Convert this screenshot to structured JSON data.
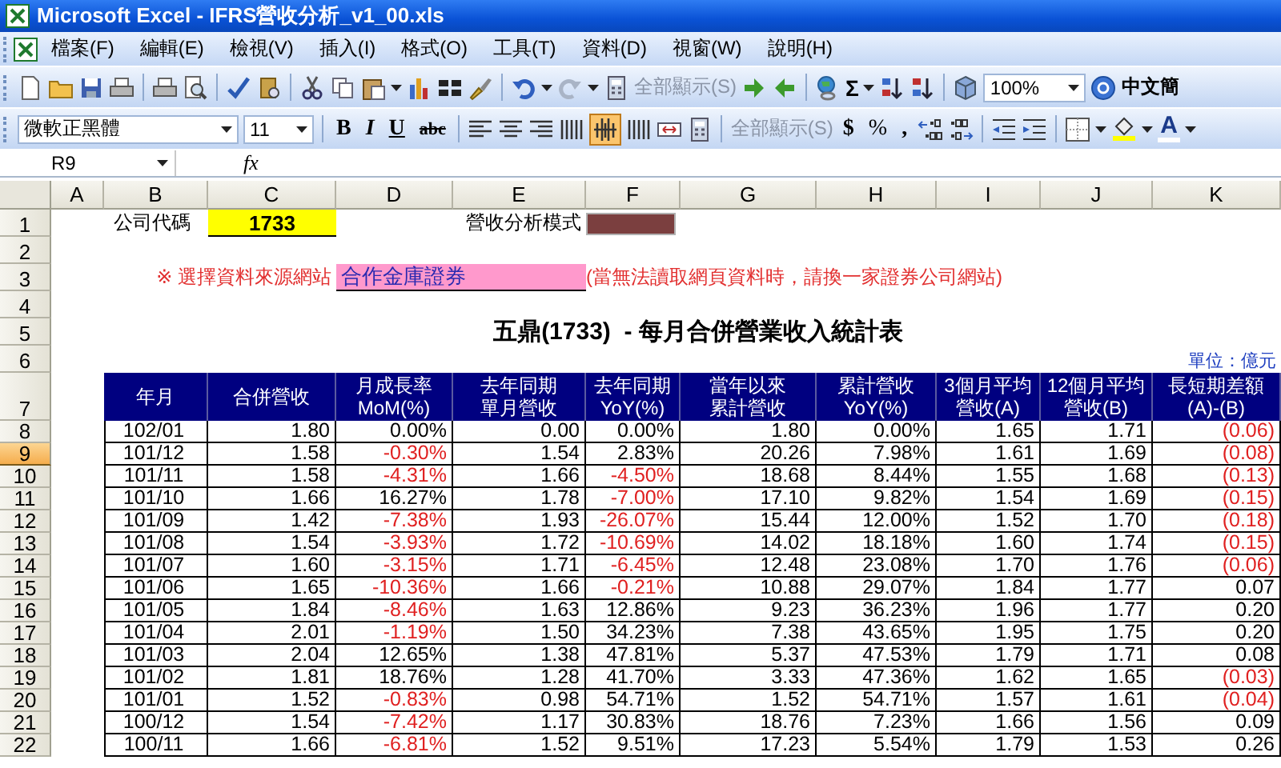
{
  "window": {
    "title": "Microsoft Excel - IFRS營收分析_v1_00.xls"
  },
  "menu": [
    "檔案(F)",
    "編輯(E)",
    "檢視(V)",
    "插入(I)",
    "格式(O)",
    "工具(T)",
    "資料(D)",
    "視窗(W)",
    "說明(H)"
  ],
  "standard_toolbar": {
    "show_all": "全部顯示(S)",
    "sum": "Σ",
    "zoom": "100%",
    "language": "中文簡"
  },
  "formatting_toolbar": {
    "font": "微軟正黑體",
    "size": "11",
    "bold": "B",
    "italic": "I",
    "underline": "U",
    "strikethrough": "abc",
    "distributed_selected": true,
    "show_all": "全部顯示(S)",
    "currency": "$",
    "percent": "%",
    "comma": ",",
    "font_color": "A"
  },
  "formula_bar": {
    "name_box": "R9",
    "function_label": "fx"
  },
  "columns": [
    "A",
    "B",
    "C",
    "D",
    "E",
    "F",
    "G",
    "H",
    "I",
    "J",
    "K"
  ],
  "rows": [
    {
      "label": "1",
      "selected": false
    },
    {
      "label": "2",
      "selected": false
    },
    {
      "label": "3",
      "selected": false
    },
    {
      "label": "4",
      "selected": false
    },
    {
      "label": "5",
      "selected": false
    },
    {
      "label": "6",
      "selected": false
    },
    {
      "label": "7",
      "selected": false
    },
    {
      "label": "8",
      "selected": false
    },
    {
      "label": "9",
      "selected": true
    },
    {
      "label": "10",
      "selected": false
    },
    {
      "label": "11",
      "selected": false
    },
    {
      "label": "12",
      "selected": false
    },
    {
      "label": "13",
      "selected": false
    },
    {
      "label": "14",
      "selected": false
    },
    {
      "label": "15",
      "selected": false
    },
    {
      "label": "16",
      "selected": false
    },
    {
      "label": "17",
      "selected": false
    },
    {
      "label": "18",
      "selected": false
    },
    {
      "label": "19",
      "selected": false
    },
    {
      "label": "20",
      "selected": false
    },
    {
      "label": "21",
      "selected": false
    },
    {
      "label": "22",
      "selected": false
    }
  ],
  "sheet": {
    "company_code_label": "公司代碼",
    "company_code": "1733",
    "mode_label": "營收分析模式",
    "source_label": "※ 選擇資料來源網站",
    "source": "合作金庫證券",
    "source_note": "(當無法讀取網頁資料時，請換一家證券公司網站)",
    "title": "五鼎(1733)  - 每月合併營業收入統計表",
    "unit": "單位：億元"
  },
  "table": {
    "columns": [
      "年月",
      "合併營收",
      "月成長率MoM(%)",
      "去年同期單月營收",
      "去年同期YoY(%)",
      "當年以來累計營收",
      "累計營收YoY(%)",
      "3個月平均營收(A)",
      "12個月平均營收(B)",
      "長短期差額(A)-(B)"
    ],
    "rows": [
      {
        "cells": [
          {
            "value": "102/01",
            "negative": false
          },
          {
            "value": "1.80",
            "negative": false
          },
          {
            "value": "0.00%",
            "negative": false
          },
          {
            "value": "0.00",
            "negative": false
          },
          {
            "value": "0.00%",
            "negative": false
          },
          {
            "value": "1.80",
            "negative": false
          },
          {
            "value": "0.00%",
            "negative": false
          },
          {
            "value": "1.65",
            "negative": false
          },
          {
            "value": "1.71",
            "negative": false
          },
          {
            "value": "(0.06)",
            "negative": true
          }
        ]
      },
      {
        "cells": [
          {
            "value": "101/12",
            "negative": false
          },
          {
            "value": "1.58",
            "negative": false
          },
          {
            "value": "-0.30%",
            "negative": true
          },
          {
            "value": "1.54",
            "negative": false
          },
          {
            "value": "2.83%",
            "negative": false
          },
          {
            "value": "20.26",
            "negative": false
          },
          {
            "value": "7.98%",
            "negative": false
          },
          {
            "value": "1.61",
            "negative": false
          },
          {
            "value": "1.69",
            "negative": false
          },
          {
            "value": "(0.08)",
            "negative": true
          }
        ]
      },
      {
        "cells": [
          {
            "value": "101/11",
            "negative": false
          },
          {
            "value": "1.58",
            "negative": false
          },
          {
            "value": "-4.31%",
            "negative": true
          },
          {
            "value": "1.66",
            "negative": false
          },
          {
            "value": "-4.50%",
            "negative": true
          },
          {
            "value": "18.68",
            "negative": false
          },
          {
            "value": "8.44%",
            "negative": false
          },
          {
            "value": "1.55",
            "negative": false
          },
          {
            "value": "1.68",
            "negative": false
          },
          {
            "value": "(0.13)",
            "negative": true
          }
        ]
      },
      {
        "cells": [
          {
            "value": "101/10",
            "negative": false
          },
          {
            "value": "1.66",
            "negative": false
          },
          {
            "value": "16.27%",
            "negative": false
          },
          {
            "value": "1.78",
            "negative": false
          },
          {
            "value": "-7.00%",
            "negative": true
          },
          {
            "value": "17.10",
            "negative": false
          },
          {
            "value": "9.82%",
            "negative": false
          },
          {
            "value": "1.54",
            "negative": false
          },
          {
            "value": "1.69",
            "negative": false
          },
          {
            "value": "(0.15)",
            "negative": true
          }
        ]
      },
      {
        "cells": [
          {
            "value": "101/09",
            "negative": false
          },
          {
            "value": "1.42",
            "negative": false
          },
          {
            "value": "-7.38%",
            "negative": true
          },
          {
            "value": "1.93",
            "negative": false
          },
          {
            "value": "-26.07%",
            "negative": true
          },
          {
            "value": "15.44",
            "negative": false
          },
          {
            "value": "12.00%",
            "negative": false
          },
          {
            "value": "1.52",
            "negative": false
          },
          {
            "value": "1.70",
            "negative": false
          },
          {
            "value": "(0.18)",
            "negative": true
          }
        ]
      },
      {
        "cells": [
          {
            "value": "101/08",
            "negative": false
          },
          {
            "value": "1.54",
            "negative": false
          },
          {
            "value": "-3.93%",
            "negative": true
          },
          {
            "value": "1.72",
            "negative": false
          },
          {
            "value": "-10.69%",
            "negative": true
          },
          {
            "value": "14.02",
            "negative": false
          },
          {
            "value": "18.18%",
            "negative": false
          },
          {
            "value": "1.60",
            "negative": false
          },
          {
            "value": "1.74",
            "negative": false
          },
          {
            "value": "(0.15)",
            "negative": true
          }
        ]
      },
      {
        "cells": [
          {
            "value": "101/07",
            "negative": false
          },
          {
            "value": "1.60",
            "negative": false
          },
          {
            "value": "-3.15%",
            "negative": true
          },
          {
            "value": "1.71",
            "negative": false
          },
          {
            "value": "-6.45%",
            "negative": true
          },
          {
            "value": "12.48",
            "negative": false
          },
          {
            "value": "23.08%",
            "negative": false
          },
          {
            "value": "1.70",
            "negative": false
          },
          {
            "value": "1.76",
            "negative": false
          },
          {
            "value": "(0.06)",
            "negative": true
          }
        ]
      },
      {
        "cells": [
          {
            "value": "101/06",
            "negative": false
          },
          {
            "value": "1.65",
            "negative": false
          },
          {
            "value": "-10.36%",
            "negative": true
          },
          {
            "value": "1.66",
            "negative": false
          },
          {
            "value": "-0.21%",
            "negative": true
          },
          {
            "value": "10.88",
            "negative": false
          },
          {
            "value": "29.07%",
            "negative": false
          },
          {
            "value": "1.84",
            "negative": false
          },
          {
            "value": "1.77",
            "negative": false
          },
          {
            "value": "0.07",
            "negative": false
          }
        ]
      },
      {
        "cells": [
          {
            "value": "101/05",
            "negative": false
          },
          {
            "value": "1.84",
            "negative": false
          },
          {
            "value": "-8.46%",
            "negative": true
          },
          {
            "value": "1.63",
            "negative": false
          },
          {
            "value": "12.86%",
            "negative": false
          },
          {
            "value": "9.23",
            "negative": false
          },
          {
            "value": "36.23%",
            "negative": false
          },
          {
            "value": "1.96",
            "negative": false
          },
          {
            "value": "1.77",
            "negative": false
          },
          {
            "value": "0.20",
            "negative": false
          }
        ]
      },
      {
        "cells": [
          {
            "value": "101/04",
            "negative": false
          },
          {
            "value": "2.01",
            "negative": false
          },
          {
            "value": "-1.19%",
            "negative": true
          },
          {
            "value": "1.50",
            "negative": false
          },
          {
            "value": "34.23%",
            "negative": false
          },
          {
            "value": "7.38",
            "negative": false
          },
          {
            "value": "43.65%",
            "negative": false
          },
          {
            "value": "1.95",
            "negative": false
          },
          {
            "value": "1.75",
            "negative": false
          },
          {
            "value": "0.20",
            "negative": false
          }
        ]
      },
      {
        "cells": [
          {
            "value": "101/03",
            "negative": false
          },
          {
            "value": "2.04",
            "negative": false
          },
          {
            "value": "12.65%",
            "negative": false
          },
          {
            "value": "1.38",
            "negative": false
          },
          {
            "value": "47.81%",
            "negative": false
          },
          {
            "value": "5.37",
            "negative": false
          },
          {
            "value": "47.53%",
            "negative": false
          },
          {
            "value": "1.79",
            "negative": false
          },
          {
            "value": "1.71",
            "negative": false
          },
          {
            "value": "0.08",
            "negative": false
          }
        ]
      },
      {
        "cells": [
          {
            "value": "101/02",
            "negative": false
          },
          {
            "value": "1.81",
            "negative": false
          },
          {
            "value": "18.76%",
            "negative": false
          },
          {
            "value": "1.28",
            "negative": false
          },
          {
            "value": "41.70%",
            "negative": false
          },
          {
            "value": "3.33",
            "negative": false
          },
          {
            "value": "47.36%",
            "negative": false
          },
          {
            "value": "1.62",
            "negative": false
          },
          {
            "value": "1.65",
            "negative": false
          },
          {
            "value": "(0.03)",
            "negative": true
          }
        ]
      },
      {
        "cells": [
          {
            "value": "101/01",
            "negative": false
          },
          {
            "value": "1.52",
            "negative": false
          },
          {
            "value": "-0.83%",
            "negative": true
          },
          {
            "value": "0.98",
            "negative": false
          },
          {
            "value": "54.71%",
            "negative": false
          },
          {
            "value": "1.52",
            "negative": false
          },
          {
            "value": "54.71%",
            "negative": false
          },
          {
            "value": "1.57",
            "negative": false
          },
          {
            "value": "1.61",
            "negative": false
          },
          {
            "value": "(0.04)",
            "negative": true
          }
        ]
      },
      {
        "cells": [
          {
            "value": "100/12",
            "negative": false
          },
          {
            "value": "1.54",
            "negative": false
          },
          {
            "value": "-7.42%",
            "negative": true
          },
          {
            "value": "1.17",
            "negative": false
          },
          {
            "value": "30.83%",
            "negative": false
          },
          {
            "value": "18.76",
            "negative": false
          },
          {
            "value": "7.23%",
            "negative": false
          },
          {
            "value": "1.66",
            "negative": false
          },
          {
            "value": "1.56",
            "negative": false
          },
          {
            "value": "0.09",
            "negative": false
          }
        ]
      },
      {
        "cells": [
          {
            "value": "100/11",
            "negative": false
          },
          {
            "value": "1.66",
            "negative": false
          },
          {
            "value": "-6.81%",
            "negative": true
          },
          {
            "value": "1.52",
            "negative": false
          },
          {
            "value": "9.51%",
            "negative": false
          },
          {
            "value": "17.23",
            "negative": false
          },
          {
            "value": "5.54%",
            "negative": false
          },
          {
            "value": "1.79",
            "negative": false
          },
          {
            "value": "1.53",
            "negative": false
          },
          {
            "value": "0.26",
            "negative": false
          }
        ]
      }
    ]
  }
}
